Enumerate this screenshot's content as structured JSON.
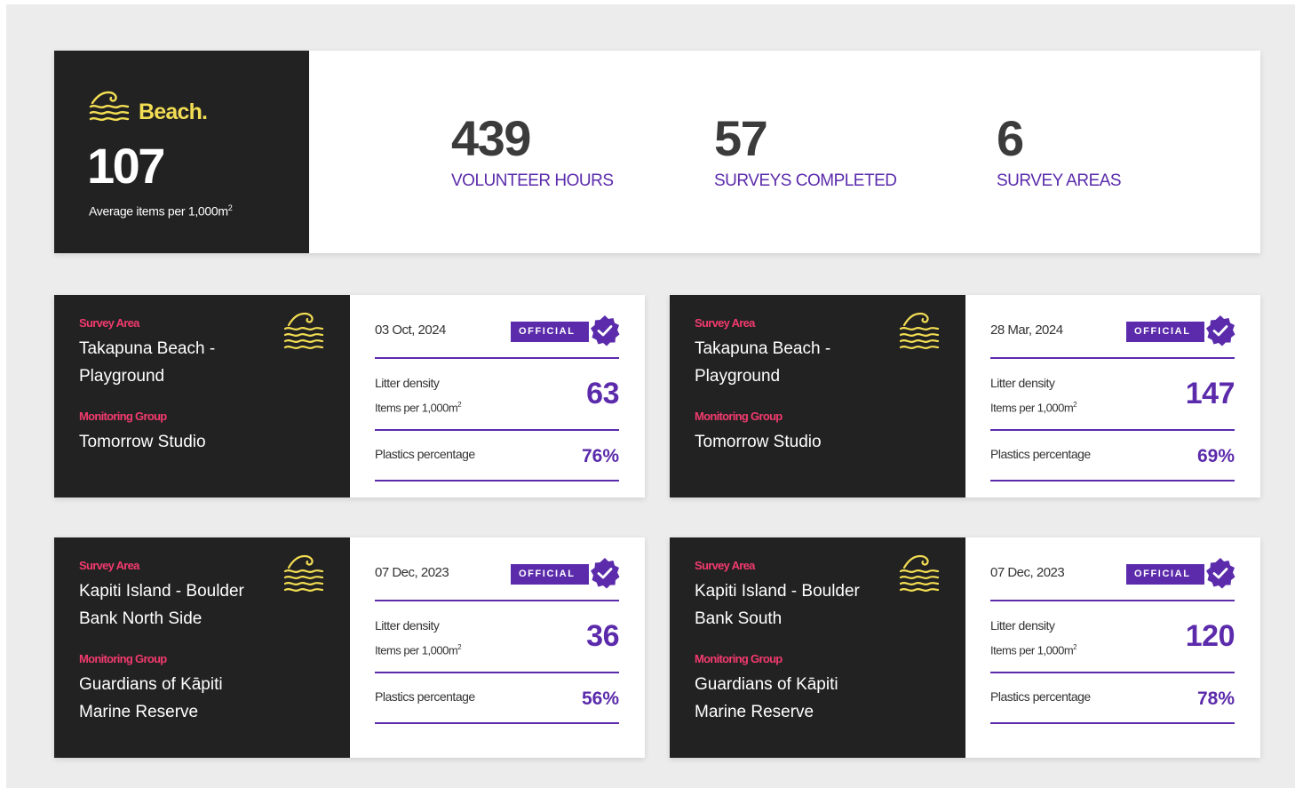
{
  "summary": {
    "icon": "wave-icon",
    "category": "Beach.",
    "average_value": "107",
    "average_caption": "Average items per 1,000m",
    "average_caption_sup": "2",
    "stats": [
      {
        "value": "439",
        "label": "VOLUNTEER HOURS"
      },
      {
        "value": "57",
        "label": "SURVEYS COMPLETED"
      },
      {
        "value": "6",
        "label": "SURVEY AREAS"
      }
    ]
  },
  "labels": {
    "survey_area": "Survey Area",
    "monitoring_group": "Monitoring Group",
    "official": "OFFICIAL",
    "litter_density": "Litter density",
    "items_per": "Items per 1,000m",
    "items_per_sup": "2",
    "plastics_percentage": "Plastics percentage"
  },
  "cards": [
    {
      "area_line1": "Takapuna Beach -",
      "area_line2": "Playground",
      "group_line1": "Tomorrow Studio",
      "group_line2": "",
      "date": "03 Oct, 2024",
      "litter_density": "63",
      "plastics": "76%"
    },
    {
      "area_line1": "Takapuna Beach -",
      "area_line2": "Playground",
      "group_line1": "Tomorrow Studio",
      "group_line2": "",
      "date": "28 Mar, 2024",
      "litter_density": "147",
      "plastics": "69%"
    },
    {
      "area_line1": "Kapiti Island - Boulder",
      "area_line2": "Bank North Side",
      "group_line1": "Guardians of Kāpiti",
      "group_line2": "Marine Reserve",
      "date": "07 Dec, 2023",
      "litter_density": "36",
      "plastics": "56%"
    },
    {
      "area_line1": "Kapiti Island - Boulder",
      "area_line2": "Bank South",
      "group_line1": "Guardians of Kāpiti",
      "group_line2": "Marine Reserve",
      "date": "07 Dec, 2023",
      "litter_density": "120",
      "plastics": "78%"
    }
  ],
  "colors": {
    "dark_panel": "#222222",
    "accent_purple": "#5b2bab",
    "accent_pink": "#f23a6e",
    "accent_yellow": "#f2dd53"
  }
}
